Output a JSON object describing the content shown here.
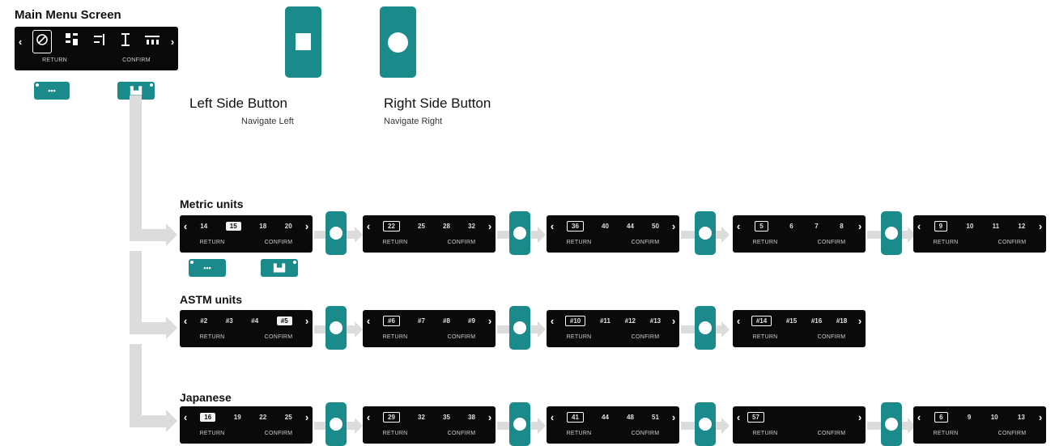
{
  "main_menu": {
    "title": "Main Menu Screen",
    "return_label": "RETURN",
    "confirm_label": "CONFIRM",
    "icons": [
      "reset-icon",
      "grid-icon",
      "adjust-icon",
      "measure-icon",
      "spacing-icon"
    ]
  },
  "left_button": {
    "title": "Left Side Button",
    "subtitle": "Navigate Left"
  },
  "right_button": {
    "title": "Right Side Button",
    "subtitle": "Navigate Right"
  },
  "rows": [
    {
      "title": "Metric units",
      "screens": [
        {
          "values": [
            "14",
            "15",
            "18",
            "20"
          ],
          "style": "fill",
          "sel": 1
        },
        {
          "values": [
            "22",
            "25",
            "28",
            "32"
          ],
          "style": "box",
          "sel": 0
        },
        {
          "values": [
            "36",
            "40",
            "44",
            "50"
          ],
          "style": "box",
          "sel": 0
        },
        {
          "values": [
            "5",
            "6",
            "7",
            "8"
          ],
          "style": "box",
          "sel": 0
        },
        {
          "values": [
            "9",
            "10",
            "11",
            "12"
          ],
          "style": "box",
          "sel": 0
        }
      ]
    },
    {
      "title": "ASTM units",
      "screens": [
        {
          "values": [
            "#2",
            "#3",
            "#4",
            "#5"
          ],
          "style": "fill",
          "sel": 3
        },
        {
          "values": [
            "#6",
            "#7",
            "#8",
            "#9"
          ],
          "style": "box",
          "sel": 0
        },
        {
          "values": [
            "#10",
            "#11",
            "#12",
            "#13"
          ],
          "style": "box",
          "sel": 0
        },
        {
          "values": [
            "#14",
            "#15",
            "#16",
            "#18"
          ],
          "style": "box",
          "sel": 0
        }
      ]
    },
    {
      "title": "Japanese",
      "screens": [
        {
          "values": [
            "16",
            "19",
            "22",
            "25"
          ],
          "style": "fill",
          "sel": 0
        },
        {
          "values": [
            "29",
            "32",
            "35",
            "38"
          ],
          "style": "box",
          "sel": 0
        },
        {
          "values": [
            "41",
            "44",
            "48",
            "51"
          ],
          "style": "box",
          "sel": 0
        },
        {
          "values": [
            "57"
          ],
          "style": "box",
          "sel": 0
        },
        {
          "values": [
            "6",
            "9",
            "10",
            "13"
          ],
          "style": "box",
          "sel": 0
        }
      ]
    }
  ],
  "screen_labels": {
    "return": "RETURN",
    "confirm": "CONFIRM"
  },
  "colors": {
    "teal": "#1a8a8a",
    "screen_bg": "#0a0a0a",
    "connector": "#d9d9d9"
  }
}
